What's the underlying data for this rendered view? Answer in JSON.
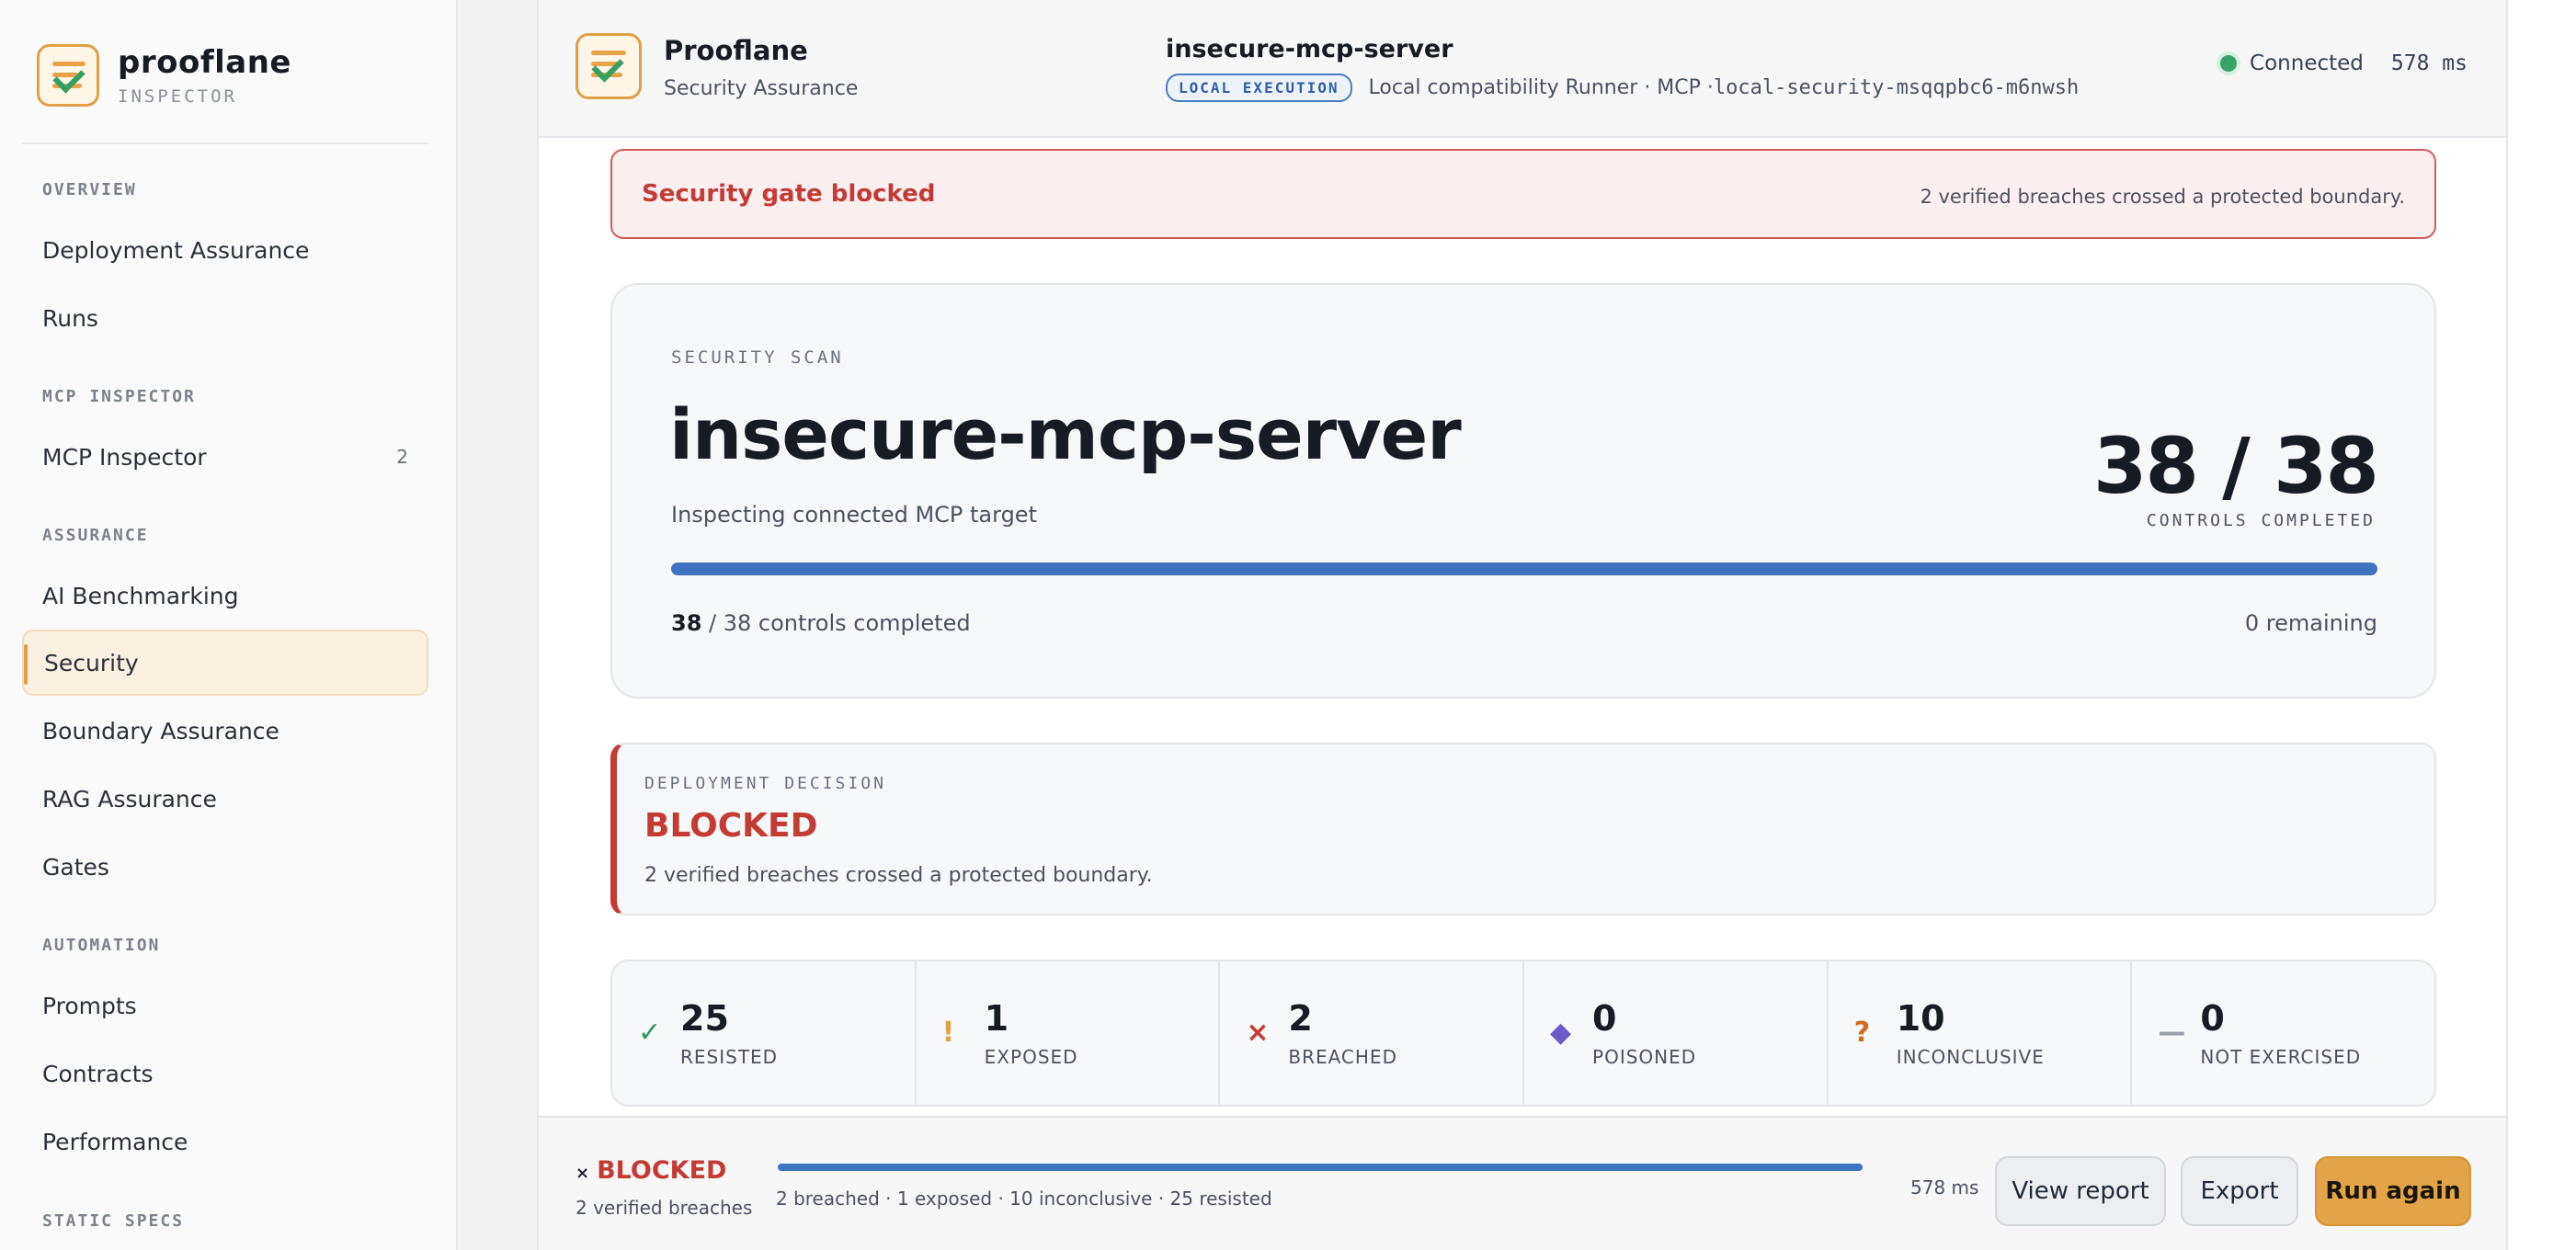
{
  "brand": {
    "name": "prooflane",
    "subtitle": "INSPECTOR"
  },
  "sidebar": {
    "sections": [
      {
        "label": "OVERVIEW"
      },
      {
        "label": "MCP INSPECTOR"
      },
      {
        "label": "ASSURANCE"
      },
      {
        "label": "AUTOMATION"
      },
      {
        "label": "STATIC SPECS"
      }
    ],
    "items": [
      {
        "label": "Deployment Assurance"
      },
      {
        "label": "Runs"
      },
      {
        "label": "MCP Inspector",
        "count": "2"
      },
      {
        "label": "AI Benchmarking"
      },
      {
        "label": "Security",
        "active": true
      },
      {
        "label": "Boundary Assurance"
      },
      {
        "label": "RAG Assurance"
      },
      {
        "label": "Gates"
      },
      {
        "label": "Prompts"
      },
      {
        "label": "Contracts"
      },
      {
        "label": "Performance"
      }
    ]
  },
  "header": {
    "title": "Prooflane",
    "subtitle": "Security Assurance",
    "target": "insecure-mcp-server",
    "badge": "LOCAL EXECUTION",
    "runner": "Local compatibility Runner · MCP · ",
    "run_id": "local-security-msqqpbc6-m6nwsh",
    "status": "Connected",
    "latency": "578 ms",
    "status_color": "#3aa36b"
  },
  "alert": {
    "title": "Security gate blocked",
    "detail": "2 verified breaches crossed a protected boundary."
  },
  "scan": {
    "eyebrow": "SECURITY SCAN",
    "title": "insecure-mcp-server",
    "subtitle": "Inspecting connected MCP target",
    "count": "38 / 38",
    "count_label": "CONTROLS COMPLETED",
    "completed": "38",
    "completed_rest": " / 38 controls completed",
    "remaining": "0 remaining",
    "progress": 1.0
  },
  "decision": {
    "eyebrow": "DEPLOYMENT DECISION",
    "value": "BLOCKED",
    "detail": "2 verified breaches crossed a protected boundary.",
    "color": "#c43a35"
  },
  "stats": [
    {
      "icon": "✓",
      "icon_name": "check-icon",
      "value": "25",
      "label": "RESISTED",
      "color": "#2f9a5e"
    },
    {
      "icon": "!",
      "icon_name": "exclamation-icon",
      "value": "1",
      "label": "EXPOSED",
      "color": "#e1a048"
    },
    {
      "icon": "×",
      "icon_name": "cross-icon",
      "value": "2",
      "label": "BREACHED",
      "color": "#c43a35"
    },
    {
      "icon": "◆",
      "icon_name": "diamond-icon",
      "value": "0",
      "label": "POISONED",
      "color": "#6b5bc9"
    },
    {
      "icon": "?",
      "icon_name": "question-icon",
      "value": "10",
      "label": "INCONCLUSIVE",
      "color": "#d26a1f"
    },
    {
      "icon": "—",
      "icon_name": "dash-icon",
      "value": "0",
      "label": "NOT EXERCISED",
      "color": "#9aa0a8"
    }
  ],
  "footer": {
    "status_icon": "×",
    "status": "BLOCKED",
    "sub": "2 verified breaches",
    "summary": "2 breached · 1 exposed · 10 inconclusive · 25 resisted",
    "latency": "578 ms",
    "progress": 1.0,
    "view_report": "View report",
    "export": "Export",
    "run_again": "Run again"
  }
}
